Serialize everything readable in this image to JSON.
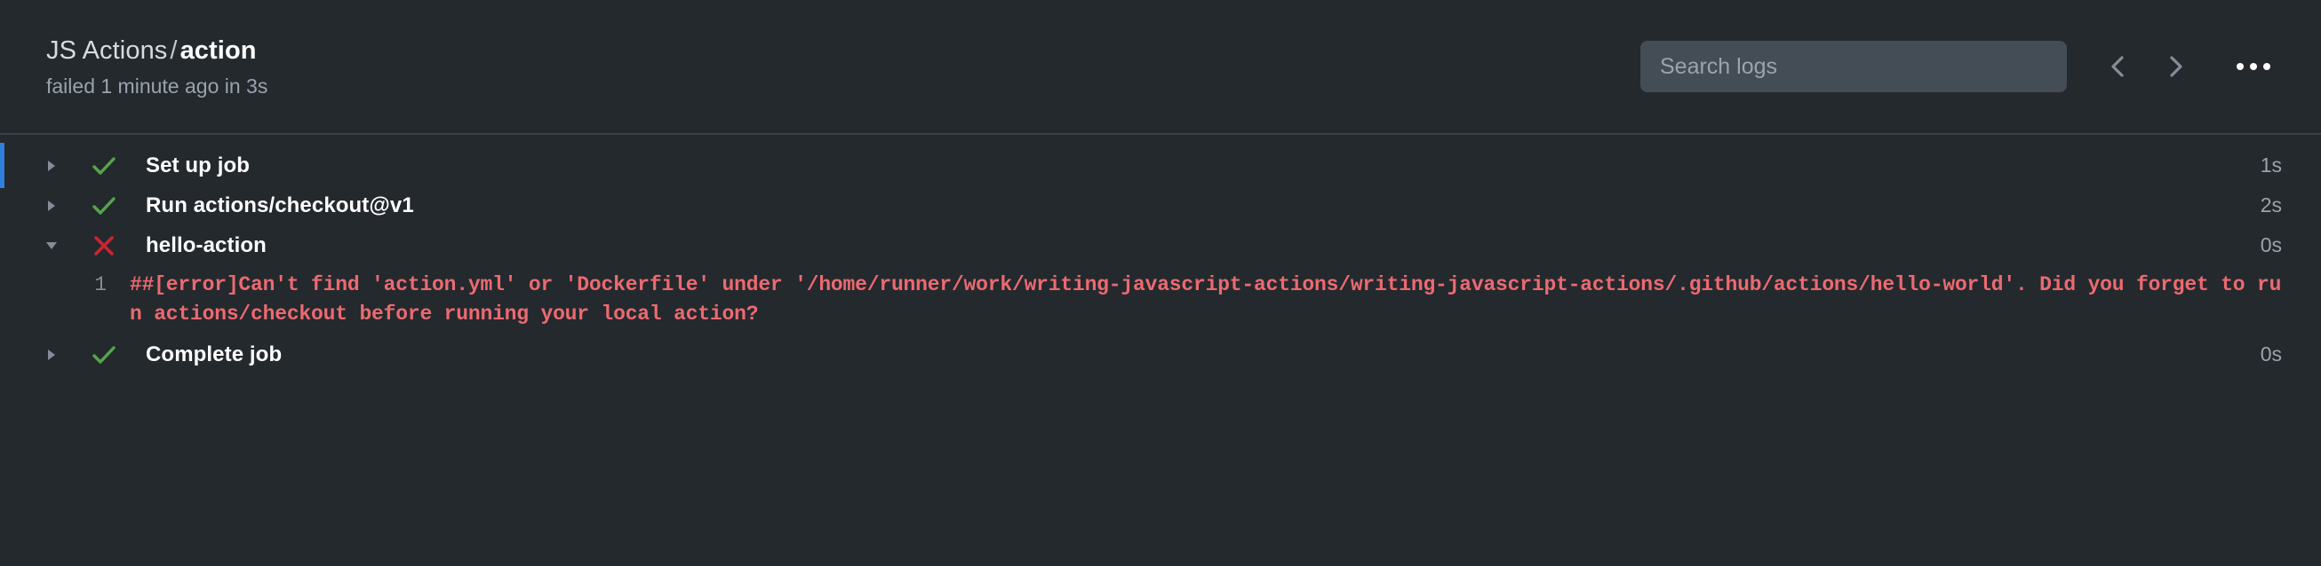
{
  "header": {
    "breadcrumb_parent": "JS Actions",
    "breadcrumb_separator": "/",
    "breadcrumb_current": "action",
    "status_line": "failed 1 minute ago in 3s",
    "search_placeholder": "Search logs",
    "search_value": "",
    "prev_icon": "chevron-left-icon",
    "next_icon": "chevron-right-icon",
    "menu_icon": "kebab-menu-icon"
  },
  "colors": {
    "background": "#24292e",
    "divider": "#3b4148",
    "accent_bar": "#2f7fdc",
    "success": "#56a64a",
    "failure": "#cb2431",
    "error_text": "#ec6a70",
    "muted_text": "#9aa3ad",
    "search_field": "#444d56"
  },
  "steps": [
    {
      "name": "Set up job",
      "status": "success",
      "status_icon": "check-icon",
      "duration": "1s",
      "expanded": false,
      "active": true,
      "twisty_icon": "triangle-right-icon",
      "lines": []
    },
    {
      "name": "Run actions/checkout@v1",
      "status": "success",
      "status_icon": "check-icon",
      "duration": "2s",
      "expanded": false,
      "active": false,
      "twisty_icon": "triangle-right-icon",
      "lines": []
    },
    {
      "name": "hello-action",
      "status": "failure",
      "status_icon": "x-icon",
      "duration": "0s",
      "expanded": true,
      "active": false,
      "twisty_icon": "triangle-down-icon",
      "lines": [
        {
          "number": "1",
          "text": "##[error]Can't find 'action.yml' or 'Dockerfile' under '/home/runner/work/writing-javascript-actions/writing-javascript-actions/.github/actions/hello-world'. Did you forget to run actions/checkout before running your local action?"
        }
      ]
    },
    {
      "name": "Complete job",
      "status": "success",
      "status_icon": "check-icon",
      "duration": "0s",
      "expanded": false,
      "active": false,
      "twisty_icon": "triangle-right-icon",
      "lines": []
    }
  ]
}
